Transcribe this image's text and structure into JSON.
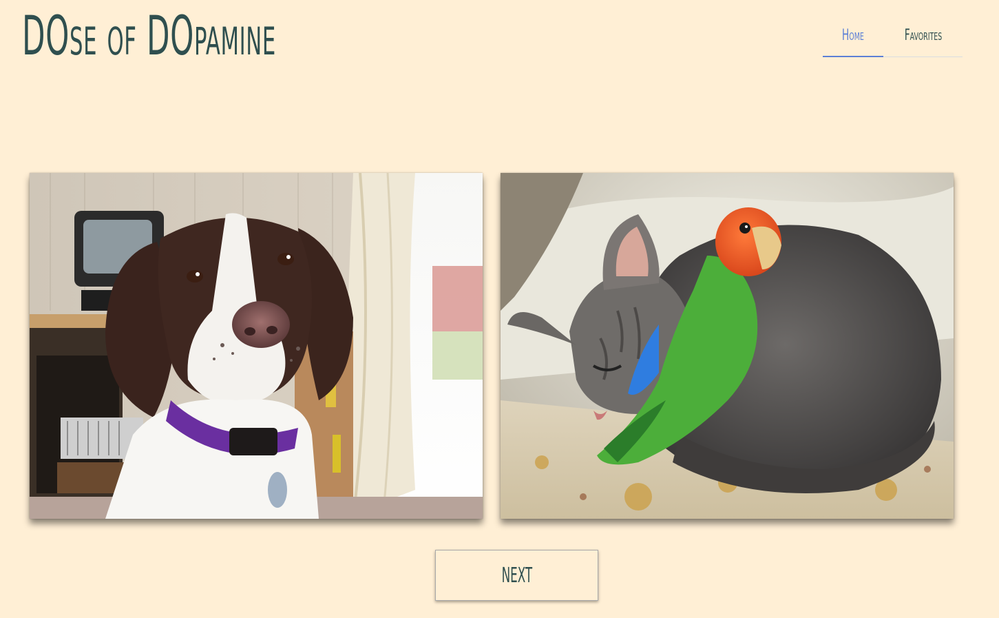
{
  "header": {
    "brand": "DOse of DOpamine",
    "nav": {
      "home_label": "Home",
      "favorites_label": "Favorites",
      "active": "Home"
    }
  },
  "images": [
    {
      "name": "photo-dog",
      "subject": "brown and white spaniel with purple collar"
    },
    {
      "name": "photo-cat-parrot",
      "subject": "grey kitten sleeping with green lovebird"
    }
  ],
  "actions": {
    "next_label": "NEXT"
  },
  "colors": {
    "background": "#ffefd5",
    "text": "#2f4f4f",
    "accent": "#5b7fd6"
  }
}
